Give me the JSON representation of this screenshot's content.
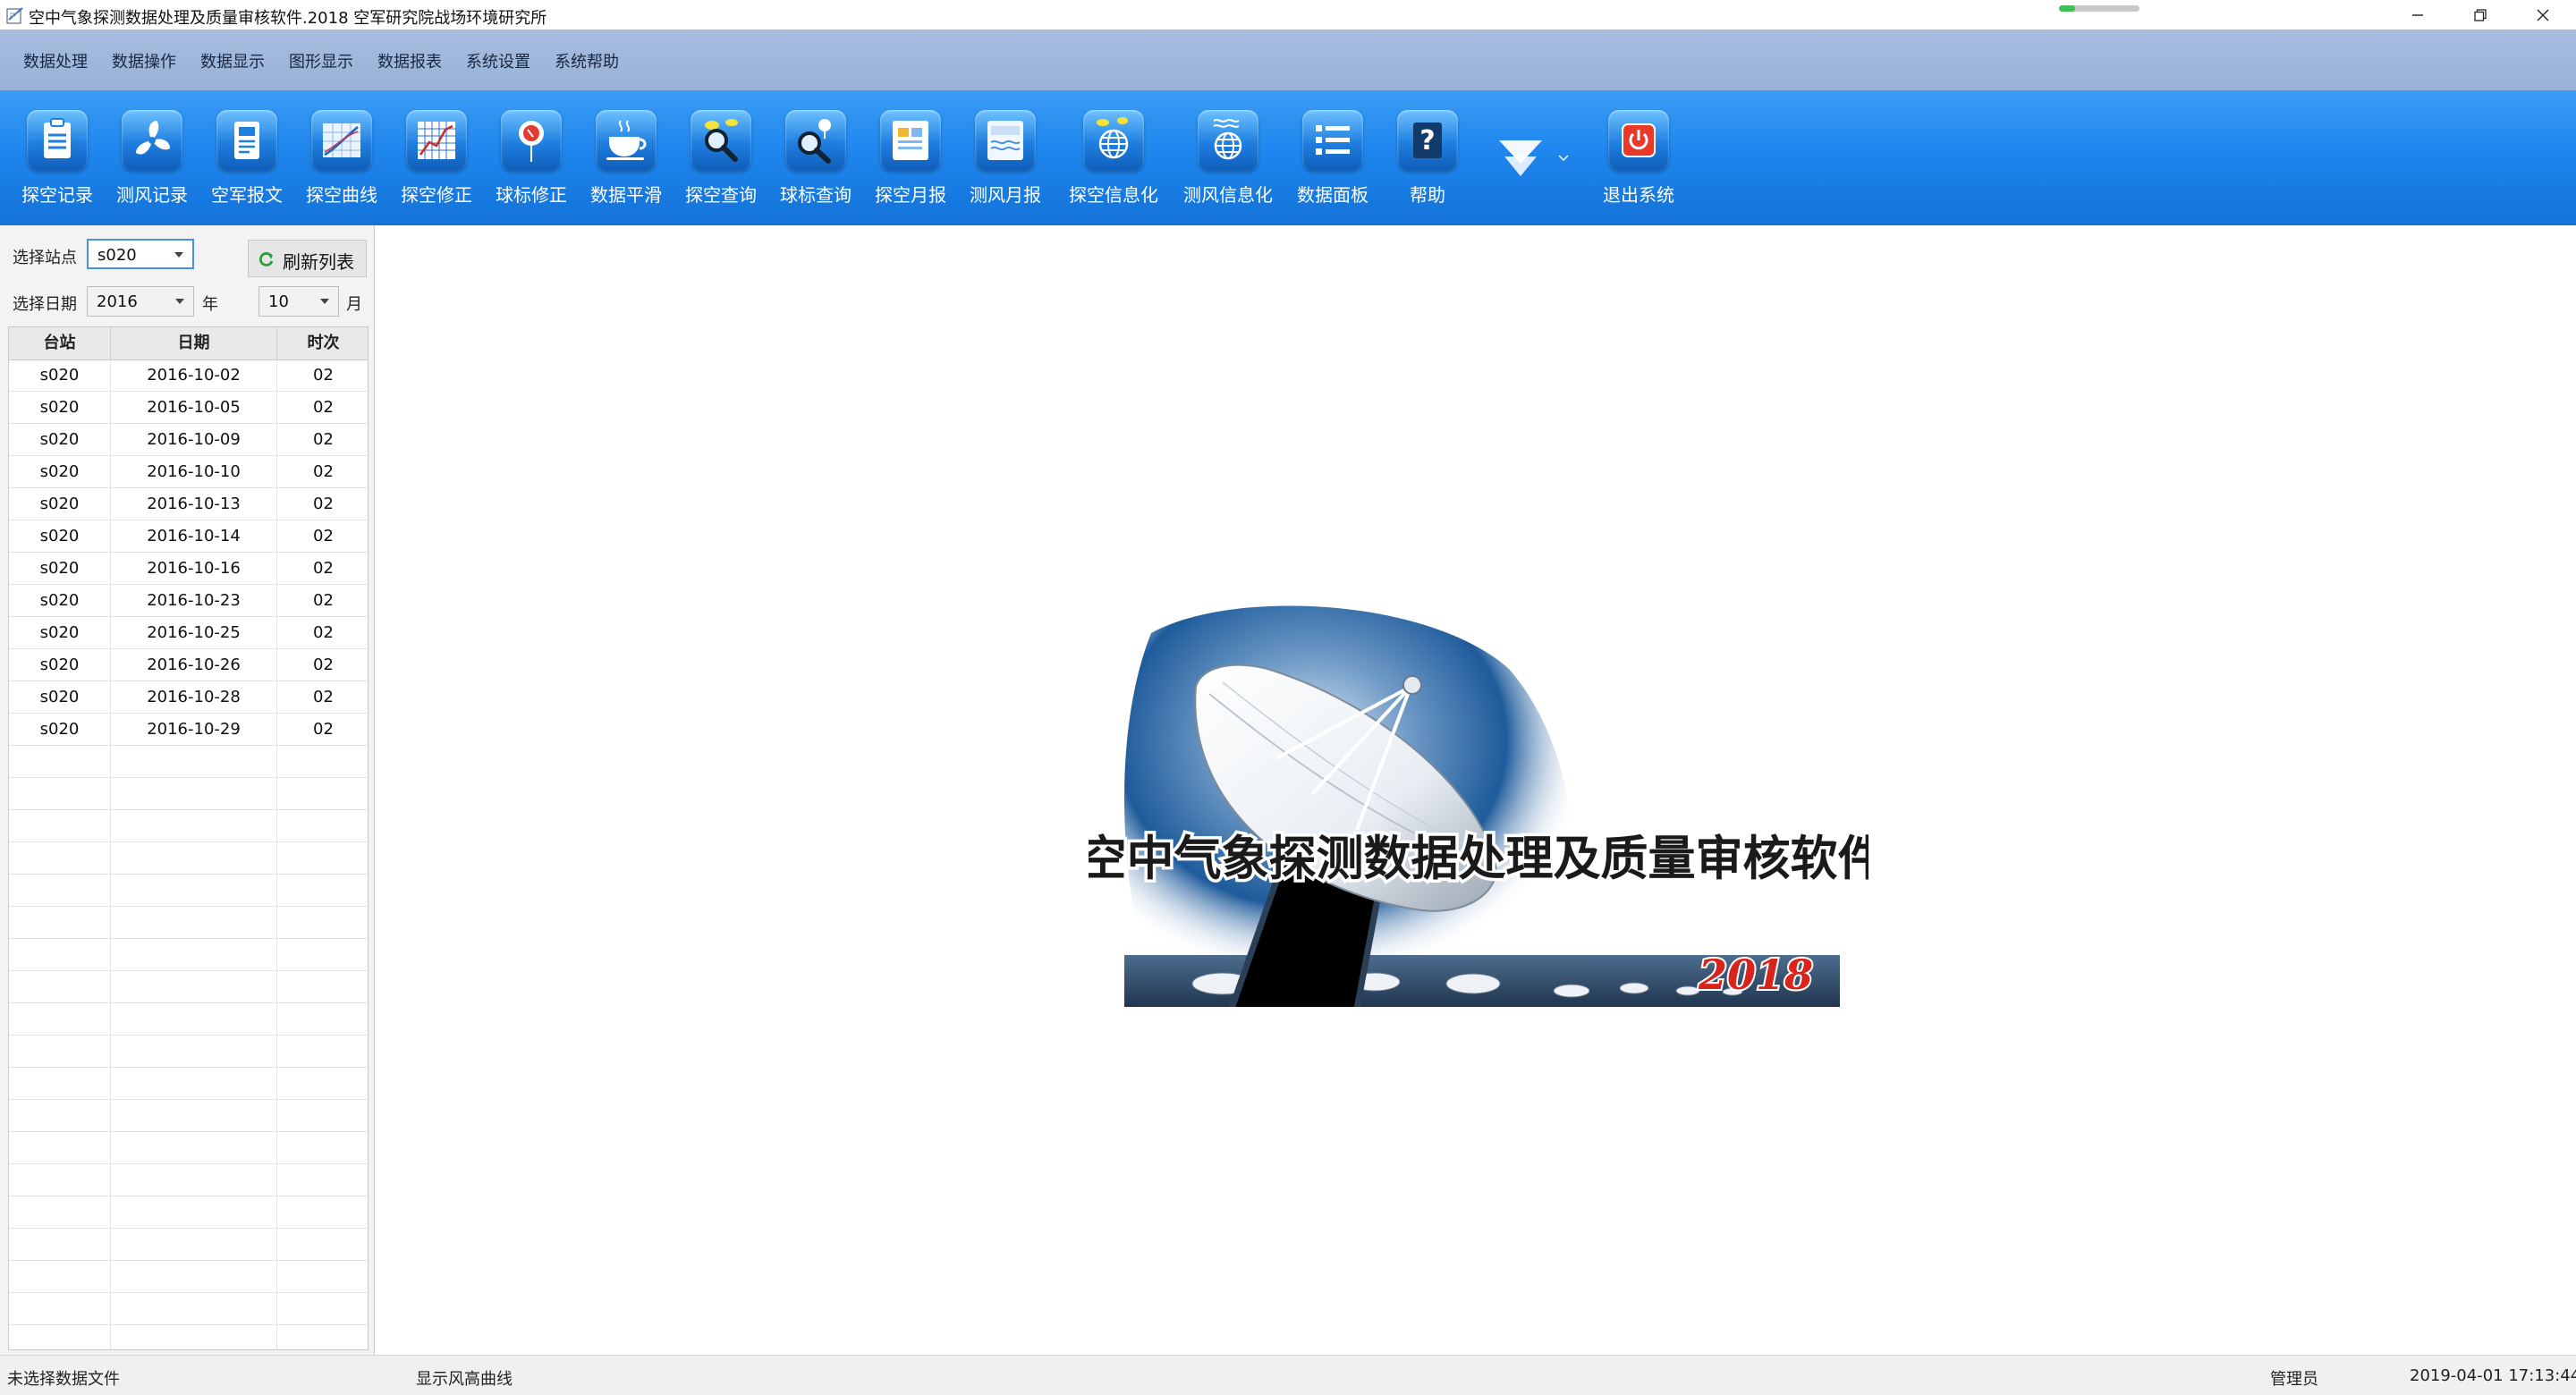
{
  "window": {
    "title": "空中气象探测数据处理及质量审核软件.2018  空军研究院战场环境研究所",
    "progress_fraction": 0.2
  },
  "menu": [
    "数据处理",
    "数据操作",
    "数据显示",
    "图形显示",
    "数据报表",
    "系统设置",
    "系统帮助"
  ],
  "toolbar": {
    "buttons": [
      {
        "label": "探空记录",
        "icon": "clipboard-icon"
      },
      {
        "label": "测风记录",
        "icon": "fan-icon"
      },
      {
        "label": "空军报文",
        "icon": "document-icon"
      },
      {
        "label": "探空曲线",
        "icon": "curve-chart-icon"
      },
      {
        "label": "探空修正",
        "icon": "grid-chart-icon"
      },
      {
        "label": "球标修正",
        "icon": "balloon-icon"
      },
      {
        "label": "数据平滑",
        "icon": "coffee-cup-icon"
      },
      {
        "label": "探空查询",
        "icon": "magnifier-icon"
      },
      {
        "label": "球标查询",
        "icon": "balloon-search-icon"
      },
      {
        "label": "探空月报",
        "icon": "monthly-report-icon"
      },
      {
        "label": "测风月报",
        "icon": "wind-report-icon"
      },
      {
        "label": "探空信息化",
        "icon": "globe-icon"
      },
      {
        "label": "测风信息化",
        "icon": "globe-waves-icon"
      },
      {
        "label": "数据面板",
        "icon": "list-icon"
      },
      {
        "label": "帮助",
        "icon": "help-icon"
      },
      {
        "label": "",
        "icon": "dropdown-arrow-icon"
      },
      {
        "label": "退出系统",
        "icon": "power-icon"
      }
    ]
  },
  "filters": {
    "station_label": "选择站点",
    "station_value": "s020",
    "refresh_label": "刷新列表",
    "date_label": "选择日期",
    "year_value": "2016",
    "year_unit": "年",
    "month_value": "10",
    "month_unit": "月"
  },
  "table": {
    "columns": [
      "台站",
      "日期",
      "时次"
    ],
    "rows": [
      [
        "s020",
        "2016-10-02",
        "02"
      ],
      [
        "s020",
        "2016-10-05",
        "02"
      ],
      [
        "s020",
        "2016-10-09",
        "02"
      ],
      [
        "s020",
        "2016-10-10",
        "02"
      ],
      [
        "s020",
        "2016-10-13",
        "02"
      ],
      [
        "s020",
        "2016-10-14",
        "02"
      ],
      [
        "s020",
        "2016-10-16",
        "02"
      ],
      [
        "s020",
        "2016-10-23",
        "02"
      ],
      [
        "s020",
        "2016-10-25",
        "02"
      ],
      [
        "s020",
        "2016-10-26",
        "02"
      ],
      [
        "s020",
        "2016-10-28",
        "02"
      ],
      [
        "s020",
        "2016-10-29",
        "02"
      ]
    ],
    "empty_rows": 19
  },
  "splash": {
    "title": "空中气象探测数据处理及质量审核软件",
    "year": "2018"
  },
  "status": {
    "file": "未选择数据文件",
    "mode": "显示风高曲线",
    "user": "管理员",
    "datetime": "2019-04-01 17:13:44"
  },
  "colors": {
    "menubar": "#a2b8dd",
    "toolbar": "#1e86ee",
    "exit_icon": "#e83a2a",
    "splash_year": "#d8241a"
  }
}
